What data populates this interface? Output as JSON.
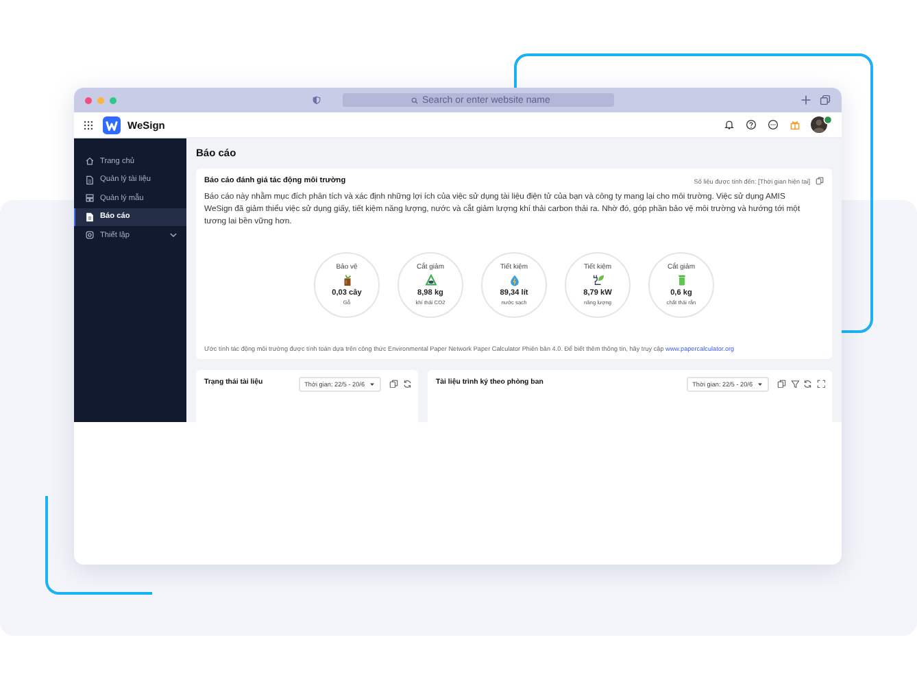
{
  "browser": {
    "address_placeholder": "Search or enter website name"
  },
  "app": {
    "name": "WeSign"
  },
  "sidebar": {
    "items": [
      {
        "label": "Trang chủ",
        "kind": "home",
        "selected": false
      },
      {
        "label": "Quản lý tài liệu",
        "kind": "document",
        "selected": false
      },
      {
        "label": "Quản lý mẫu",
        "kind": "template",
        "selected": false
      },
      {
        "label": "Báo cáo",
        "kind": "report",
        "selected": true
      },
      {
        "label": "Thiết lập",
        "kind": "settings",
        "selected": false
      }
    ]
  },
  "page_title": "Báo cáo",
  "report": {
    "title": "Báo cáo đánh giá tác động môi trường",
    "as_of": "Số liệu được tính đến: [Thời gian hiện tại]",
    "description": "Báo cáo này nhằm mục đích phân tích và xác định những lợi ích của việc sử dụng tài liệu điện tử của bạn và công ty mang lại cho môi trường. Việc sử dụng AMIS WeSign đã giảm thiểu việc sử dụng giấy, tiết kiệm năng lượng, nước và cắt giảm lượng khí thải carbon thải ra. Nhờ đó, góp phần bảo vệ môi trường và hướng tới một tương lai bền vững hơn.",
    "metrics": [
      {
        "kind": "tree",
        "label": "Bảo vệ",
        "value": "0,03 cây",
        "unit": "Gỗ"
      },
      {
        "kind": "recycle",
        "label": "Cắt giảm",
        "value": "8,98 kg",
        "unit": "khí thải CO2"
      },
      {
        "kind": "water",
        "label": "Tiết kiệm",
        "value": "89,34 lít",
        "unit": "nước sạch"
      },
      {
        "kind": "energy",
        "label": "Tiết kiệm",
        "value": "8,79 kW",
        "unit": "năng lượng"
      },
      {
        "kind": "waste",
        "label": "Cắt giảm",
        "value": "0,6 kg",
        "unit": "chất thải rắn"
      }
    ],
    "footnote": "Ước tính tác động môi trường được tính toán dựa trên công thức Environmental Paper Network Paper Calculator Phiên bản 4.0. Để biết thêm thông tin, hãy truy cập ",
    "link": "www.papercalculator.org"
  },
  "panels": [
    {
      "kind": "compact",
      "title": "Trạng thái tài liệu",
      "period": "Thời gian: 22/5 - 20/6"
    },
    {
      "kind": "full",
      "title": "Tài liệu trình ký theo phòng ban",
      "period": "Thời gian: 22/5 - 20/6"
    }
  ]
}
